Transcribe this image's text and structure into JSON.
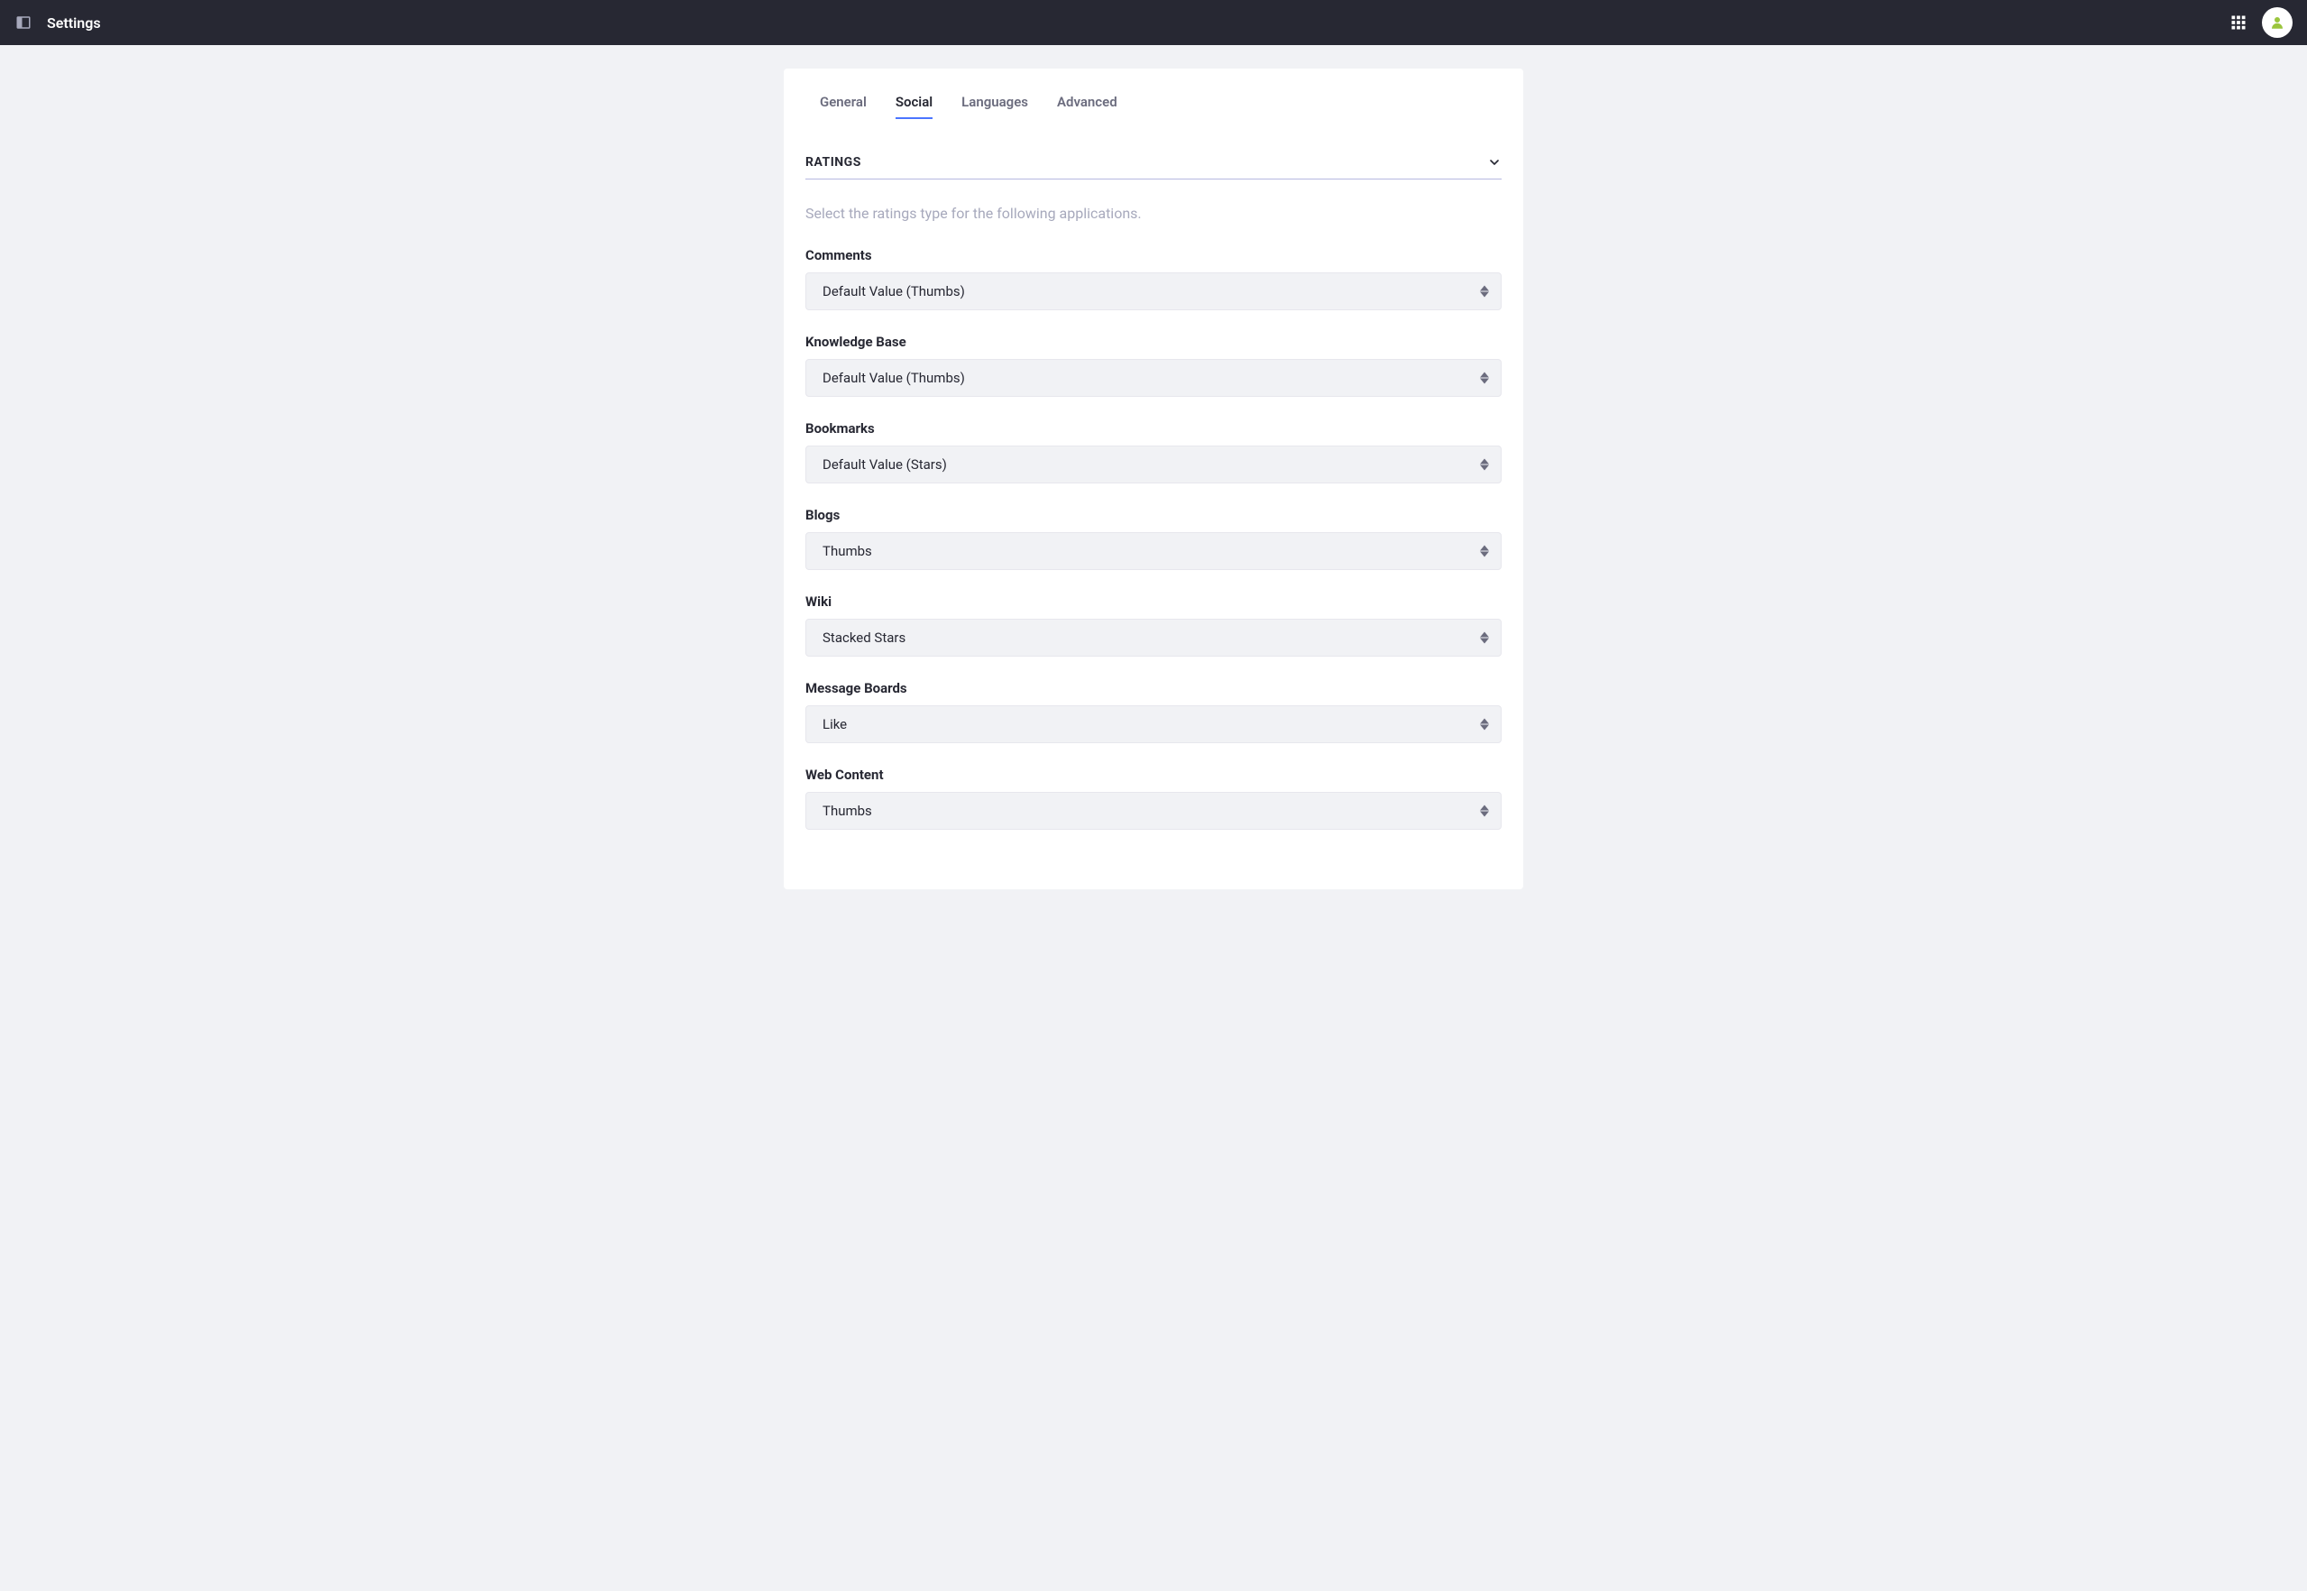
{
  "header": {
    "title": "Settings"
  },
  "tabs": [
    {
      "label": "General",
      "active": false
    },
    {
      "label": "Social",
      "active": true
    },
    {
      "label": "Languages",
      "active": false
    },
    {
      "label": "Advanced",
      "active": false
    }
  ],
  "section": {
    "title": "RATINGS",
    "description": "Select the ratings type for the following applications."
  },
  "fields": [
    {
      "label": "Comments",
      "value": "Default Value (Thumbs)"
    },
    {
      "label": "Knowledge Base",
      "value": "Default Value (Thumbs)"
    },
    {
      "label": "Bookmarks",
      "value": "Default Value (Stars)"
    },
    {
      "label": "Blogs",
      "value": "Thumbs"
    },
    {
      "label": "Wiki",
      "value": "Stacked Stars"
    },
    {
      "label": "Message Boards",
      "value": "Like"
    },
    {
      "label": "Web Content",
      "value": "Thumbs"
    }
  ]
}
